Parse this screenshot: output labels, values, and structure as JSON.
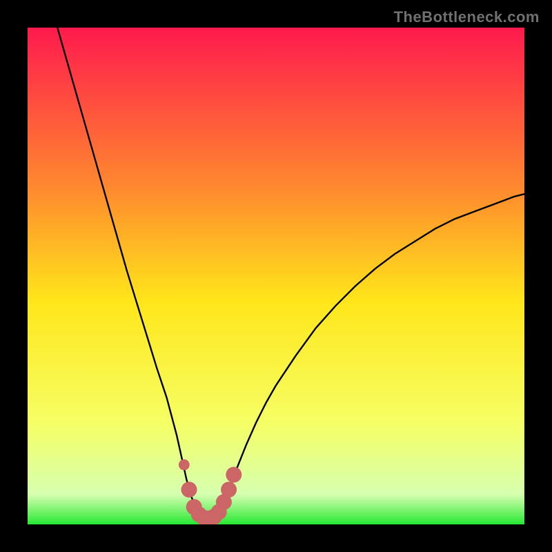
{
  "watermark": "TheBottleneck.com",
  "colors": {
    "frame": "#000000",
    "gradient_top": "#ff1a4d",
    "gradient_mid_upper": "#ff8c2e",
    "gradient_mid": "#ffe61a",
    "gradient_lower": "#f5ff66",
    "gradient_green_light": "#d6ffb0",
    "gradient_green": "#27e833",
    "curve": "#000000",
    "marker": "#cc6666"
  },
  "chart_data": {
    "type": "line",
    "title": "",
    "xlabel": "",
    "ylabel": "",
    "xlim": [
      0,
      100
    ],
    "ylim": [
      0,
      100
    ],
    "series": [
      {
        "name": "bottleneck-curve",
        "x": [
          6,
          8,
          10,
          12,
          14,
          16,
          18,
          20,
          22,
          24,
          26,
          28,
          30,
          31,
          32,
          33,
          34,
          35,
          36,
          37,
          38,
          39,
          40,
          42,
          44,
          46,
          48,
          50,
          54,
          58,
          62,
          66,
          70,
          74,
          78,
          82,
          86,
          90,
          94,
          98,
          100
        ],
        "y": [
          100,
          93,
          86,
          79,
          72,
          65,
          58,
          51,
          44.5,
          38,
          31.5,
          25.5,
          18,
          13.5,
          9,
          5.5,
          3,
          1.5,
          1,
          1,
          1.5,
          3,
          5.5,
          11,
          16,
          20.5,
          24.5,
          28,
          34,
          39.5,
          44,
          48,
          51.5,
          54.5,
          57,
          59.5,
          61.5,
          63,
          64.5,
          66,
          66.5
        ]
      }
    ],
    "markers": {
      "name": "bottom-markers",
      "points": [
        {
          "x": 31.5,
          "y": 12,
          "r": 1.1
        },
        {
          "x": 32.5,
          "y": 7,
          "r": 1.6
        },
        {
          "x": 33.5,
          "y": 3.5,
          "r": 1.6
        },
        {
          "x": 34.5,
          "y": 2,
          "r": 1.6
        },
        {
          "x": 35.5,
          "y": 1.3,
          "r": 1.6
        },
        {
          "x": 36.5,
          "y": 1.2,
          "r": 1.6
        },
        {
          "x": 37.5,
          "y": 1.5,
          "r": 1.6
        },
        {
          "x": 38.5,
          "y": 2.5,
          "r": 1.6
        },
        {
          "x": 39.5,
          "y": 4.5,
          "r": 1.6
        },
        {
          "x": 40.5,
          "y": 7,
          "r": 1.6
        },
        {
          "x": 41.5,
          "y": 10,
          "r": 1.6
        }
      ]
    }
  }
}
